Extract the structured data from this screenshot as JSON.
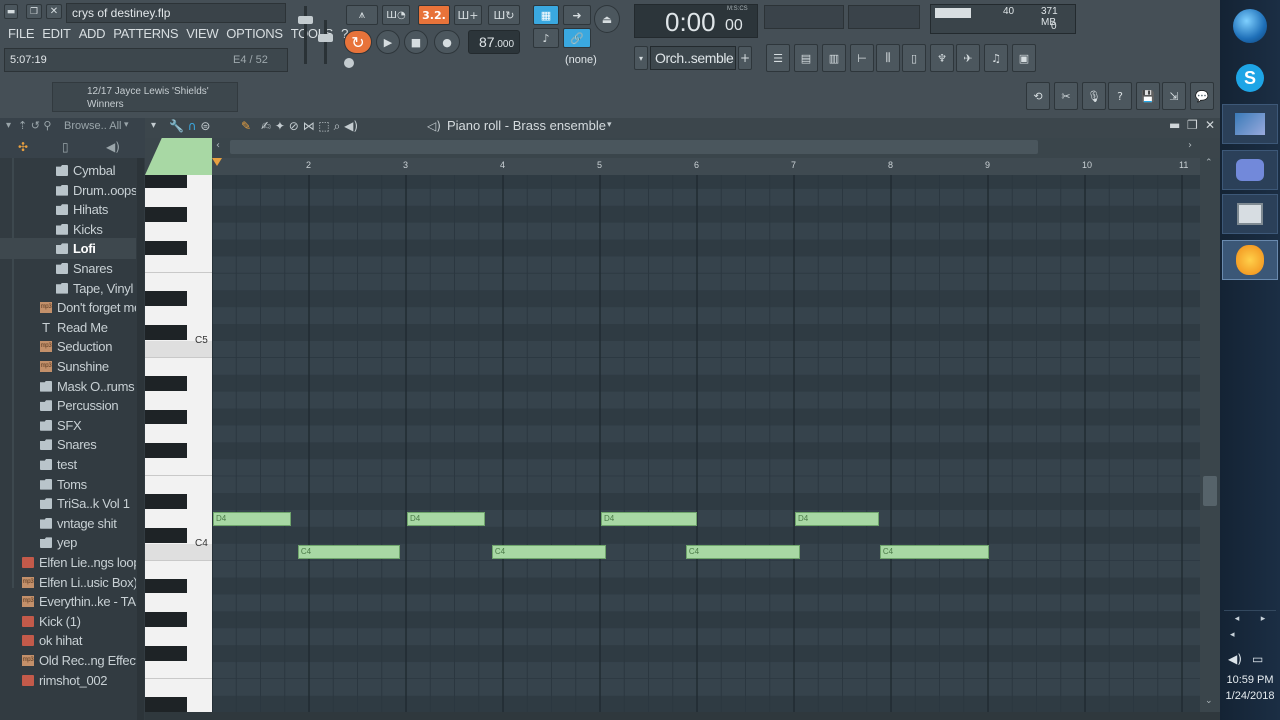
{
  "window": {
    "project_file": "crys of destiney.flp"
  },
  "menu": [
    "FILE",
    "EDIT",
    "ADD",
    "PATTERNS",
    "VIEW",
    "OPTIONS",
    "TOOLS",
    "?"
  ],
  "status": {
    "time": "5:07:19",
    "position": "E4 / 52"
  },
  "hint_bar": {
    "line1": "12/17  Jayce Lewis 'Shields'",
    "line2": "Winners"
  },
  "transport": {
    "pattern_mode": "3.2.",
    "tempo": "87",
    "tempo_decimal": ".000",
    "time_display": "0:00",
    "time_small": "00",
    "time_format": "M:S:CS",
    "snap": "(none)"
  },
  "channel": {
    "selected": "Orch..semble"
  },
  "monitor": {
    "cpu": "40",
    "memory": "371 MB",
    "polyphony": "0"
  },
  "browser": {
    "header": "Browse.. All",
    "items": [
      {
        "label": "Cymbal",
        "type": "folder",
        "indent": 2
      },
      {
        "label": "Drum..oops",
        "type": "folder",
        "indent": 2
      },
      {
        "label": "Hihats",
        "type": "folder",
        "indent": 2
      },
      {
        "label": "Kicks",
        "type": "folder",
        "indent": 2
      },
      {
        "label": "Lofi",
        "type": "folder",
        "indent": 2,
        "selected": true
      },
      {
        "label": "Snares",
        "type": "folder",
        "indent": 2
      },
      {
        "label": "Tape, Vinyl",
        "type": "folder",
        "indent": 2
      },
      {
        "label": "Don't forget me",
        "type": "mp3",
        "indent": 1
      },
      {
        "label": "Read Me",
        "type": "txt",
        "indent": 1
      },
      {
        "label": "Seduction",
        "type": "mp3",
        "indent": 1
      },
      {
        "label": "Sunshine",
        "type": "mp3",
        "indent": 1
      },
      {
        "label": "Mask O..rums",
        "type": "folder",
        "indent": 1
      },
      {
        "label": "Percussion",
        "type": "folder",
        "indent": 1
      },
      {
        "label": "SFX",
        "type": "folder",
        "indent": 1
      },
      {
        "label": "Snares",
        "type": "folder",
        "indent": 1
      },
      {
        "label": "test",
        "type": "folder",
        "indent": 1
      },
      {
        "label": "Toms",
        "type": "folder",
        "indent": 1
      },
      {
        "label": "TriSa..k Vol 1",
        "type": "folder",
        "indent": 1
      },
      {
        "label": "vntage shit",
        "type": "folder",
        "indent": 1
      },
      {
        "label": "yep",
        "type": "folder",
        "indent": 1
      },
      {
        "label": "Elfen Lie..ngs loop",
        "type": "pkg",
        "indent": 0
      },
      {
        "label": "Elfen Li..usic Box)",
        "type": "mp3",
        "indent": 0
      },
      {
        "label": "Everythin..ke - TAG",
        "type": "mp3",
        "indent": 0
      },
      {
        "label": "Kick (1)",
        "type": "pkg",
        "indent": 0
      },
      {
        "label": "ok hihat",
        "type": "pkg",
        "indent": 0
      },
      {
        "label": "Old Rec..ng Effect",
        "type": "mp3",
        "indent": 0
      },
      {
        "label": "rimshot_002",
        "type": "pkg",
        "indent": 0
      }
    ]
  },
  "piano_roll": {
    "title": "Piano roll - Brass ensemble",
    "bars": [
      "2",
      "3",
      "4",
      "5",
      "6",
      "7",
      "8",
      "9",
      "10",
      "11"
    ],
    "key_labels": {
      "c5": "C5",
      "c4": "C4"
    },
    "notes": [
      {
        "pitch": "D4",
        "start": 1.0,
        "length": 0.8
      },
      {
        "pitch": "C4",
        "start": 1.875,
        "length": 1.05
      },
      {
        "pitch": "D4",
        "start": 3.0,
        "length": 0.8
      },
      {
        "pitch": "C4",
        "start": 3.875,
        "length": 1.18
      },
      {
        "pitch": "D4",
        "start": 5.0,
        "length": 0.99
      },
      {
        "pitch": "C4",
        "start": 5.875,
        "length": 1.18
      },
      {
        "pitch": "D4",
        "start": 7.0,
        "length": 0.87
      },
      {
        "pitch": "C4",
        "start": 7.875,
        "length": 1.12
      }
    ]
  },
  "taskbar": {
    "time": "10:59 PM",
    "date": "1/24/2018"
  },
  "colors": {
    "note_fill": "#a8d8a4",
    "accent_orange": "#e8733a",
    "accent_blue": "#3aa8e0",
    "grid_bg": "#34414a"
  }
}
